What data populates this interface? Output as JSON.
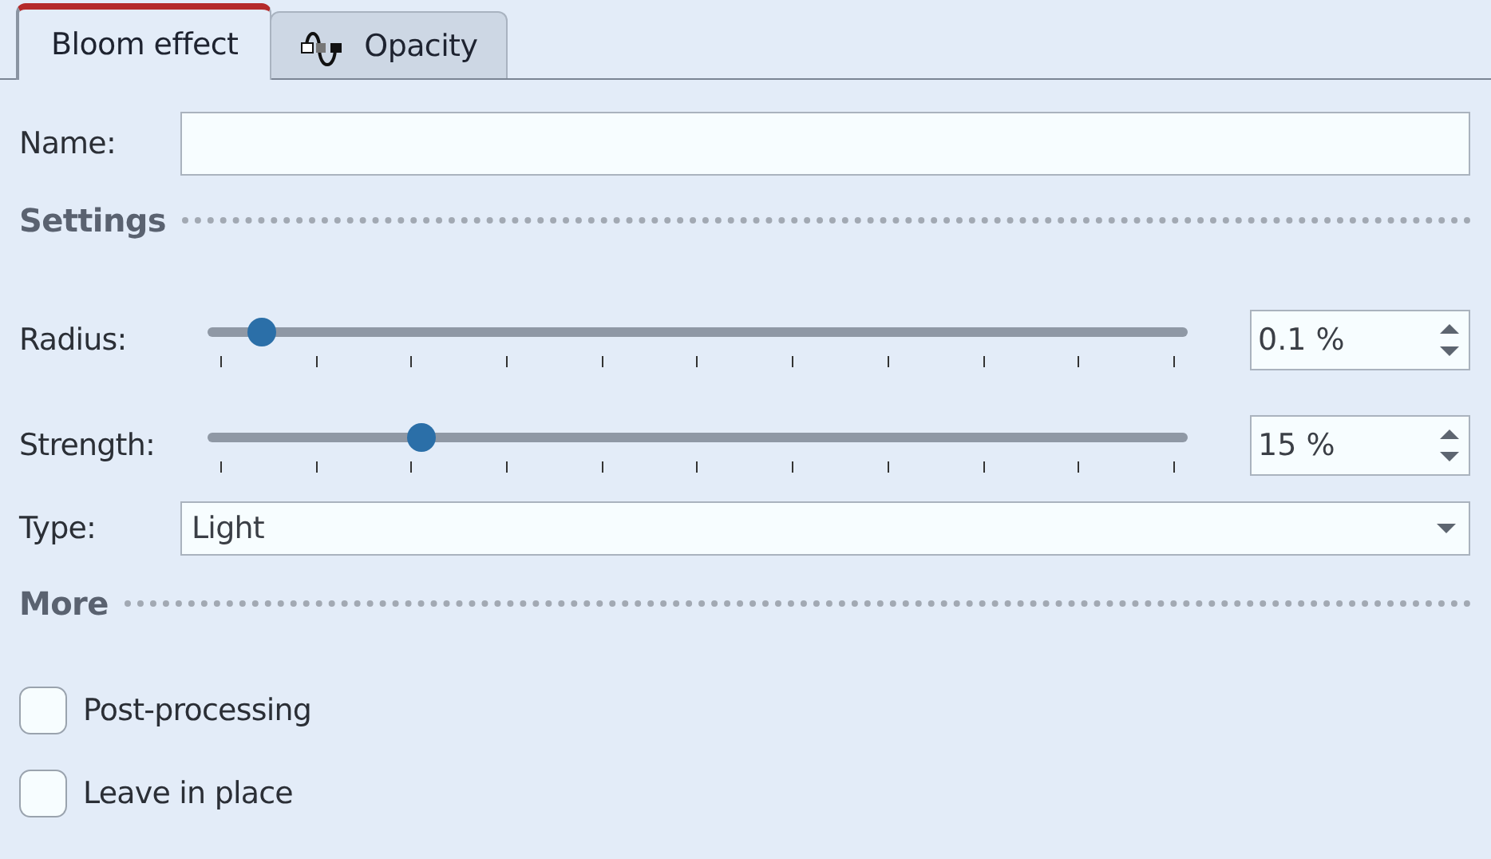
{
  "tabs": [
    {
      "label": "Bloom effect",
      "selected": true,
      "kind": "plain"
    },
    {
      "label": "Opacity",
      "selected": false,
      "kind": "wave"
    }
  ],
  "name_field": {
    "label": "Name:"
  },
  "settings": {
    "title": "Settings"
  },
  "sliders": [
    {
      "label": "Radius:",
      "level": 0.055,
      "reading": "0.1 %"
    },
    {
      "label": "Strength:",
      "level": 0.218,
      "reading": "15 %"
    }
  ],
  "type_field": {
    "label": "Type:",
    "value": "Light"
  },
  "more": {
    "title": "More"
  },
  "checkboxes": [
    {
      "label": "Post-processing",
      "checked": false
    },
    {
      "label": "Leave in place",
      "checked": false
    }
  ]
}
